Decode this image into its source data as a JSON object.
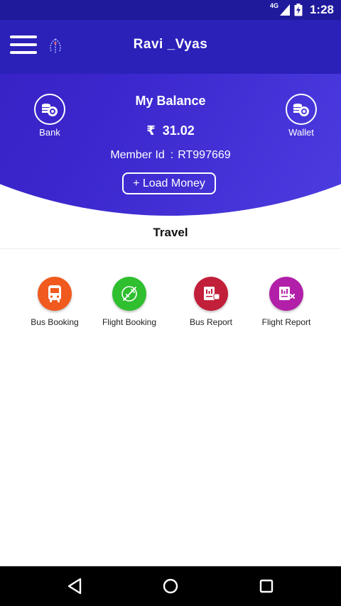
{
  "status_bar": {
    "network": "4G",
    "time": "1:28",
    "icons": [
      "signal-icon",
      "battery-icon"
    ]
  },
  "app_bar": {
    "title": "Ravi _Vyas",
    "icons": [
      "menu-icon",
      "logo-icon"
    ]
  },
  "balance": {
    "title": "My Balance",
    "currency_symbol": "₹",
    "amount": "31.02",
    "member_label": "Member Id",
    "member_separator": ":",
    "member_id": "RT997669",
    "load_button": "+ Load Money",
    "bank_label": "Bank",
    "wallet_label": "Wallet"
  },
  "section": {
    "title": "Travel"
  },
  "services": [
    {
      "label": "Bus Booking",
      "color": "#f05a1e",
      "icon": "bus-icon"
    },
    {
      "label": "Flight Booking",
      "color": "#2fbf2f",
      "icon": "plane-icon"
    },
    {
      "label": "Bus Report",
      "color": "#c21f3a",
      "icon": "bus-report-icon"
    },
    {
      "label": "Flight Report",
      "color": "#b21fa8",
      "icon": "flight-report-icon"
    }
  ],
  "nav_bar": {
    "icons": [
      "back-icon",
      "home-icon",
      "recent-apps-icon"
    ]
  },
  "colors": {
    "primary": "#2b20b8",
    "status_bar": "#1f1a9c",
    "card_gradient_start": "#2a16a6",
    "card_gradient_end": "#5a4ef0"
  }
}
